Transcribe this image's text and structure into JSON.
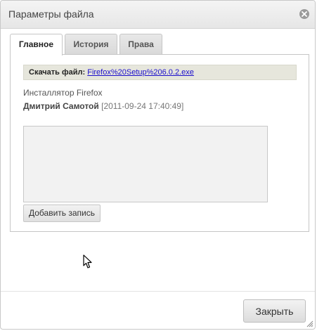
{
  "dialog": {
    "title": "Параметры файла"
  },
  "tabs": [
    {
      "label": "Главное",
      "active": true
    },
    {
      "label": "История",
      "active": false
    },
    {
      "label": "Права",
      "active": false
    }
  ],
  "file": {
    "download_label": "Скачать файл:",
    "download_link": "Firefox%20Setup%206.0.2.exe",
    "description": "Инсталлятор Firefox",
    "author": "Дмитрий Самотой",
    "date": "[2011-09-24 17:40:49]"
  },
  "note": {
    "value": "",
    "add_button_label": "Добавить запись"
  },
  "footer": {
    "close_button_label": "Закрыть"
  },
  "icons": {
    "close": "close-icon",
    "resize": "resize-grip-icon",
    "cursor": "mouse-pointer-icon"
  }
}
